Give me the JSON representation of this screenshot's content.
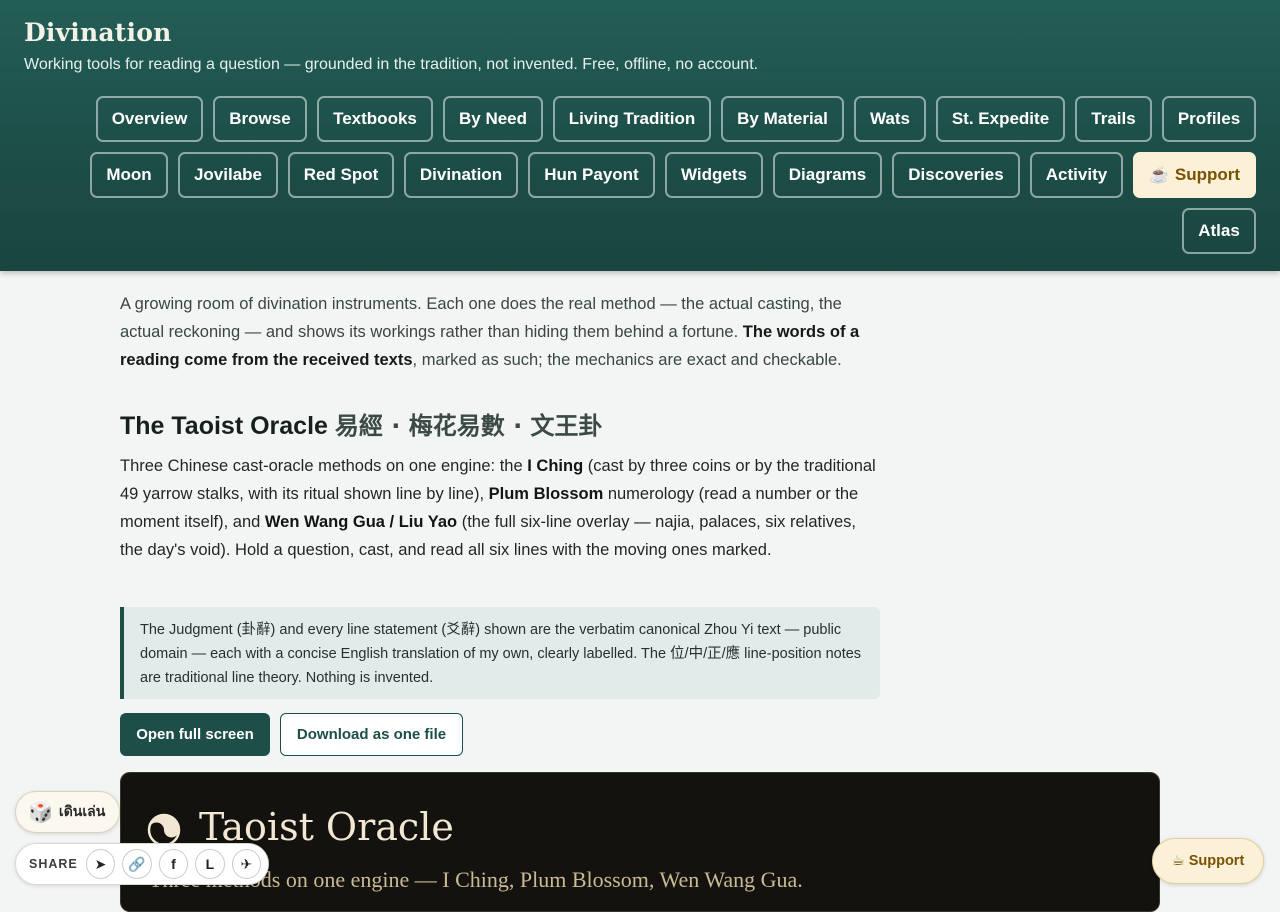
{
  "header": {
    "title": "Divination",
    "tagline": "Working tools for reading a question — grounded in the tradition, not invented. Free, offline, no account."
  },
  "nav": {
    "row1": [
      "Overview",
      "Browse",
      "Textbooks",
      "By Need",
      "Living Tradition",
      "By Material",
      "Wats",
      "St. Expedite",
      "Trails",
      "Profiles"
    ],
    "row2": [
      "Moon",
      "Jovilabe",
      "Red Spot",
      "Divination",
      "Hun Payont",
      "Widgets",
      "Diagrams",
      "Discoveries",
      "Activity"
    ],
    "support_label": "Support",
    "support_icon": "☕",
    "row3": [
      "Atlas"
    ]
  },
  "intro": {
    "text_before": "A growing room of divination instruments. Each one does the real method — the actual casting, the actual reckoning — and shows its workings rather than hiding them behind a fortune. ",
    "bold": "The words of a reading come from the received texts",
    "text_after": ", marked as such; the mechanics are exact and checkable."
  },
  "section": {
    "title": "The Taoist Oracle",
    "title_cjk": "易經 · 梅花易數 · 文王卦",
    "desc_1": "Three Chinese cast-oracle methods on one engine: the ",
    "desc_b1": "I Ching",
    "desc_2": " (cast by three coins or by the traditional 49 yarrow stalks, with its ritual shown line by line), ",
    "desc_b2": "Plum Blossom",
    "desc_3": " numerology (read a number or the moment itself), and ",
    "desc_b3": "Wen Wang Gua / Liu Yao",
    "desc_4": " (the full six-line overlay — najia, palaces, six relatives, the day's void). Hold a question, cast, and read all six lines with the moving ones marked.",
    "note": "The Judgment (卦辭) and every line statement (爻辭) shown are the verbatim canonical Zhou Yi text — public domain — each with a concise English translation of my own, clearly labelled. The 位/中/正/應 line-position notes are traditional line theory. Nothing is invented.",
    "open_button": "Open full screen",
    "download_button": "Download as one file"
  },
  "oracle": {
    "title": "Taoist Oracle",
    "subtitle": "Three methods on one engine — I Ching, Plum Blossom, Wen Wang Gua.",
    "logo_icon": "yin-yang-icon"
  },
  "widgets": {
    "random_icon": "🎲",
    "random_label": "เดินเล่น",
    "share_label": "SHARE",
    "share_buttons": [
      "➤",
      "🔗",
      "f",
      "L",
      "✈"
    ],
    "support_icon": "☕",
    "support_label": "Support"
  },
  "colors": {
    "header_bg": "#1d4e48",
    "accent": "#1d4e48",
    "support_bg": "#fbf0d8",
    "support_text": "#7a5200",
    "panel_bg": "#14120e"
  }
}
